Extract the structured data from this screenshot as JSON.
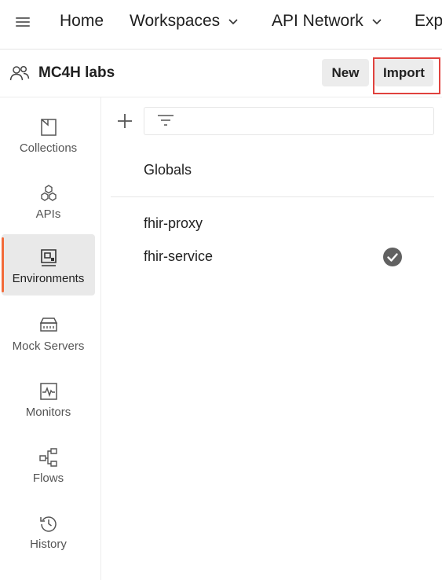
{
  "topnav": {
    "items": [
      {
        "label": "Home",
        "dropdown": false
      },
      {
        "label": "Workspaces",
        "dropdown": true
      },
      {
        "label": "API Network",
        "dropdown": true
      },
      {
        "label": "Exp",
        "dropdown": false
      }
    ]
  },
  "workspace": {
    "name": "MC4H labs",
    "new_label": "New",
    "import_label": "Import"
  },
  "sidebar": {
    "items": [
      {
        "label": "Collections",
        "icon": "collections-icon",
        "active": false
      },
      {
        "label": "APIs",
        "icon": "apis-icon",
        "active": false
      },
      {
        "label": "Environments",
        "icon": "environments-icon",
        "active": true
      },
      {
        "label": "Mock Servers",
        "icon": "mock-servers-icon",
        "active": false
      },
      {
        "label": "Monitors",
        "icon": "monitors-icon",
        "active": false
      },
      {
        "label": "Flows",
        "icon": "flows-icon",
        "active": false
      },
      {
        "label": "History",
        "icon": "history-icon",
        "active": false
      }
    ]
  },
  "environments": {
    "globals_label": "Globals",
    "items": [
      {
        "name": "fhir-proxy",
        "active": false
      },
      {
        "name": "fhir-service",
        "active": true
      }
    ]
  },
  "colors": {
    "accent": "#f26b3a",
    "highlight_border": "#e0423e",
    "active_bg": "#e9e9e9"
  }
}
